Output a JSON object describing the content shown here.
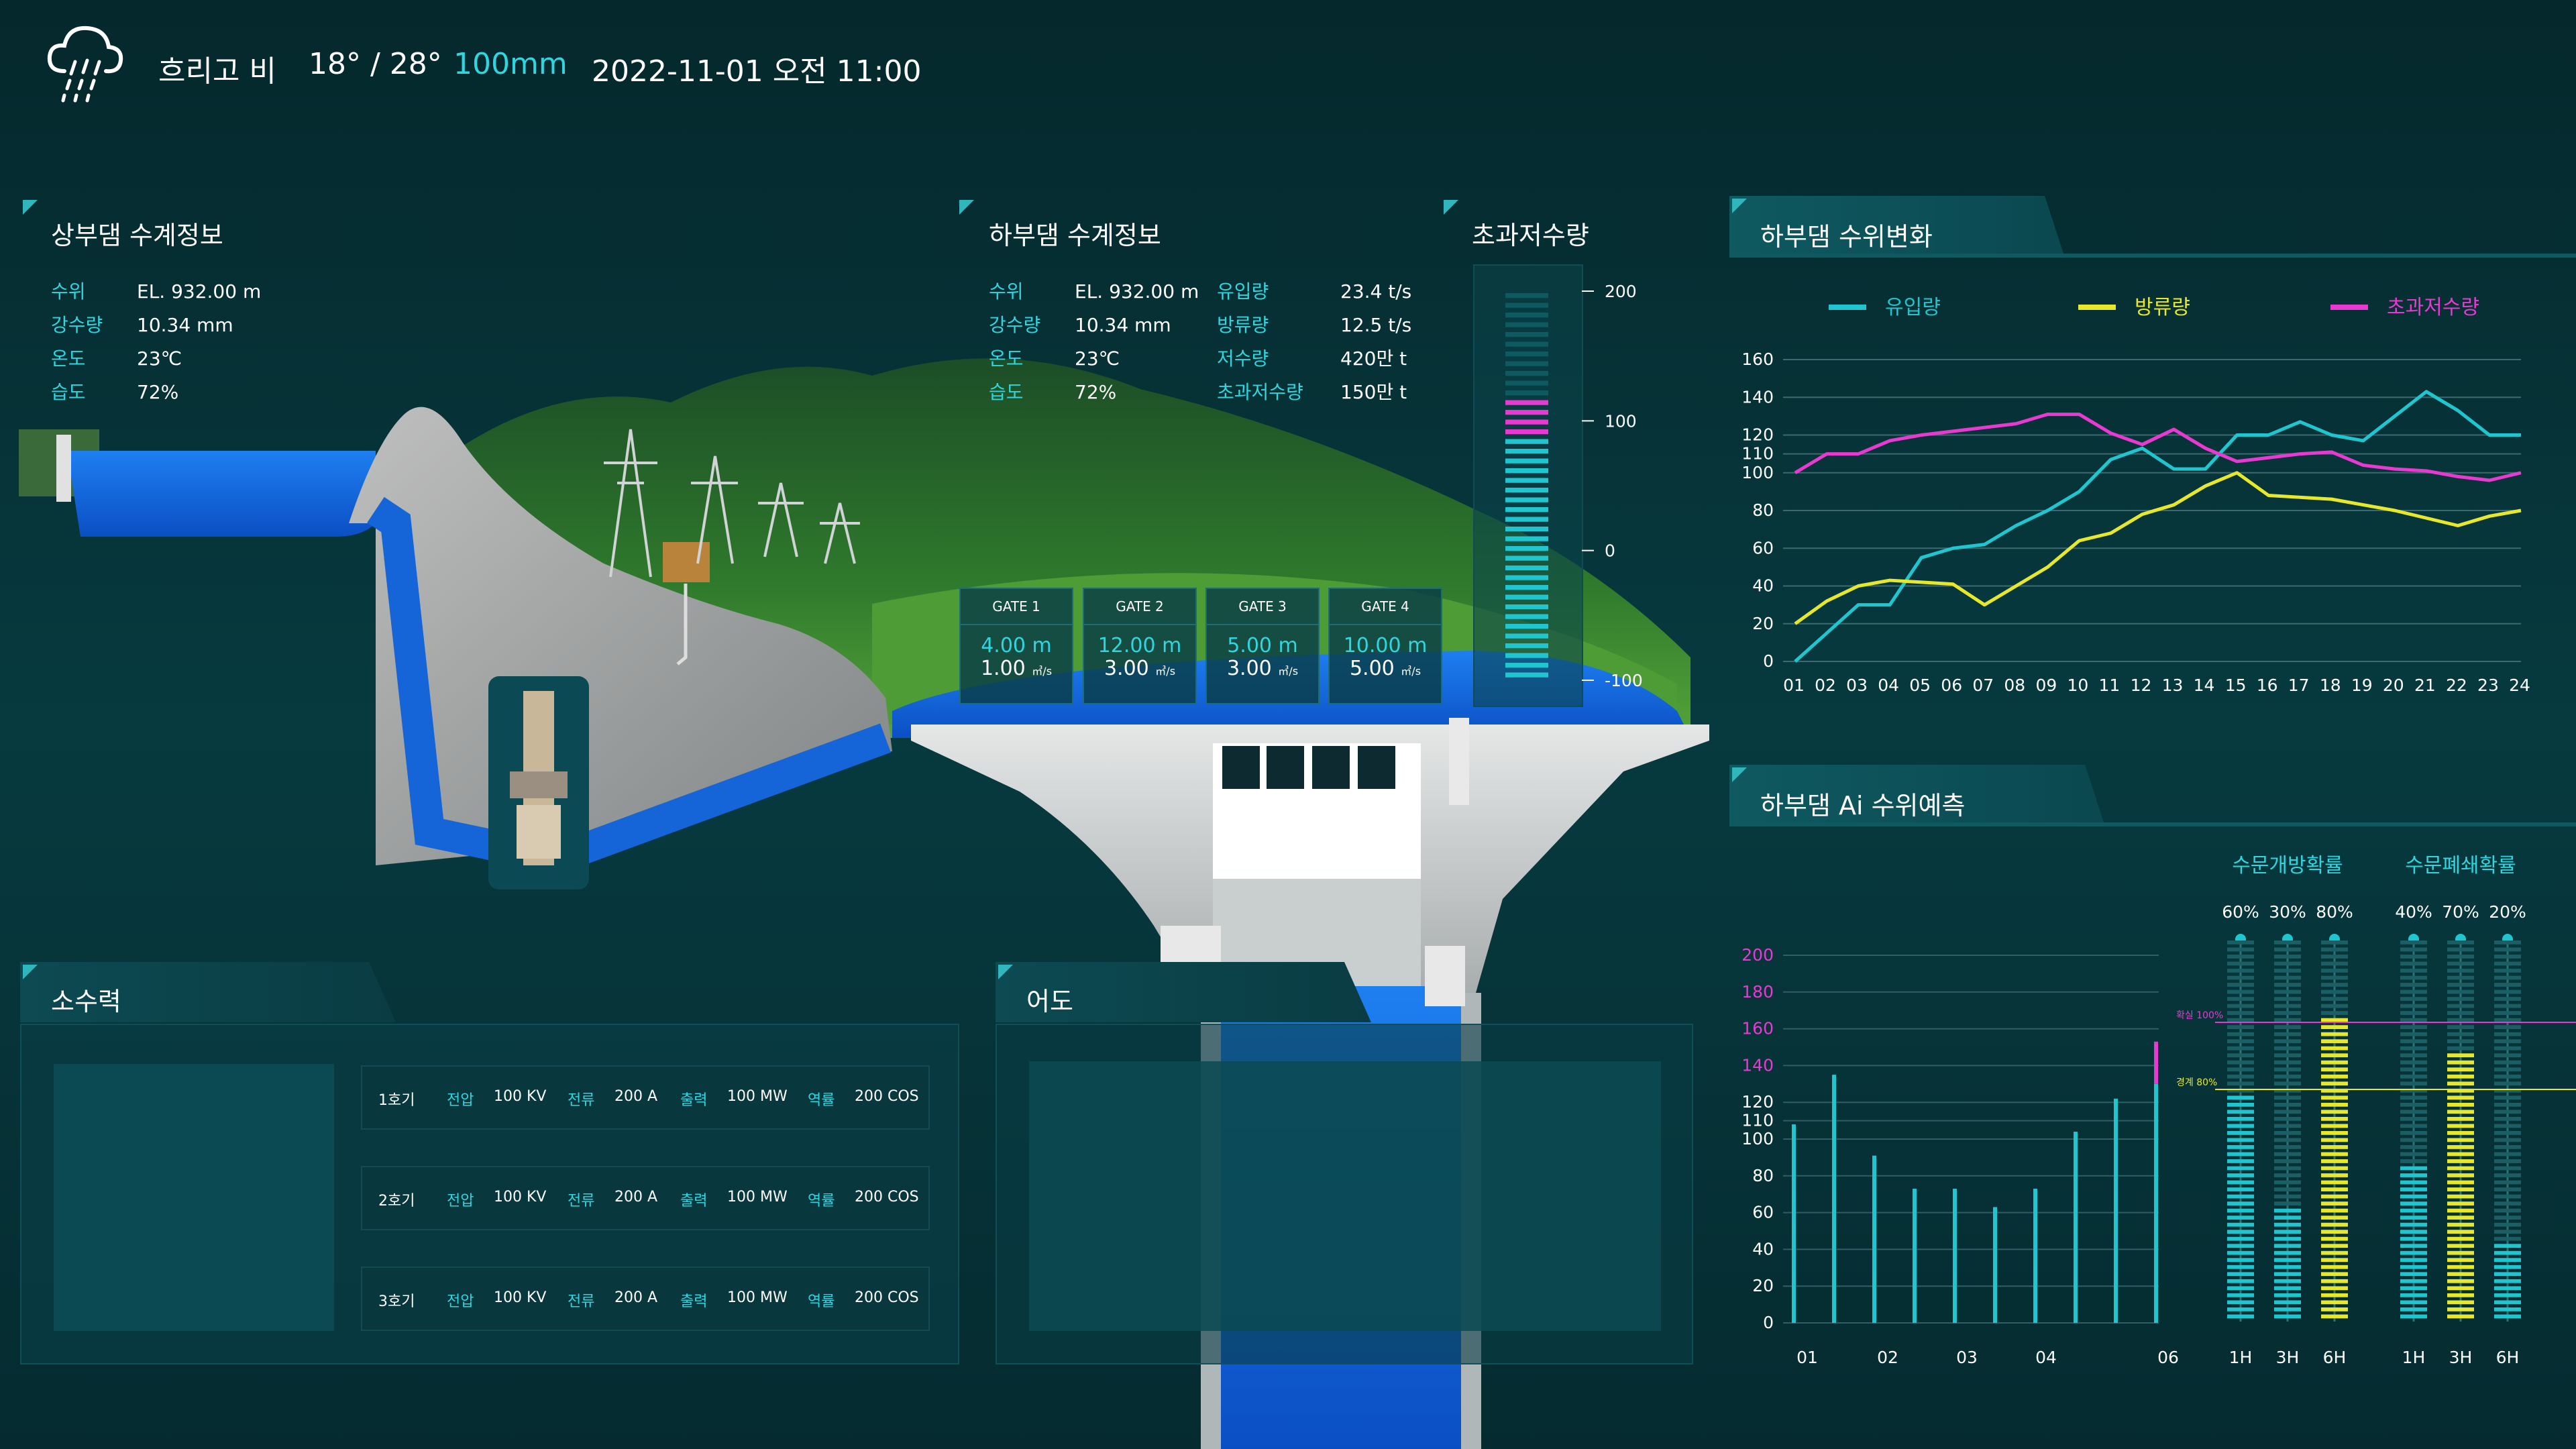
{
  "header": {
    "weather_icon": "cloud-rain-icon",
    "weather": "흐리고 비",
    "temperature": "18° / 28°",
    "rainfall": "100mm",
    "datetime": "2022-11-01 오전 11:00"
  },
  "upper_dam": {
    "title": "상부댐 수계정보",
    "rows": [
      {
        "label": "수위",
        "value": "EL. 932.00 m"
      },
      {
        "label": "강수량",
        "value": "10.34 mm"
      },
      {
        "label": "온도",
        "value": "23℃"
      },
      {
        "label": "습도",
        "value": "72%"
      }
    ]
  },
  "lower_dam": {
    "title": "하부댐 수계정보",
    "left_rows": [
      {
        "label": "수위",
        "value": "EL. 932.00 m"
      },
      {
        "label": "강수량",
        "value": "10.34 mm"
      },
      {
        "label": "온도",
        "value": "23℃"
      },
      {
        "label": "습도",
        "value": "72%"
      }
    ],
    "right_rows": [
      {
        "label": "유입량",
        "value": "23.4 t/s"
      },
      {
        "label": "방류량",
        "value": "12.5 t/s"
      },
      {
        "label": "저수량",
        "value": "420만 t"
      },
      {
        "label": "초과저수량",
        "value": "150만 t"
      }
    ]
  },
  "gates": [
    {
      "name": "GATE 1",
      "height": "4.00 m",
      "flow": "1.00",
      "unit": "㎥/s"
    },
    {
      "name": "GATE 2",
      "height": "12.00 m",
      "flow": "3.00",
      "unit": "㎥/s"
    },
    {
      "name": "GATE 3",
      "height": "5.00 m",
      "flow": "3.00",
      "unit": "㎥/s"
    },
    {
      "name": "GATE 4",
      "height": "10.00 m",
      "flow": "5.00",
      "unit": "㎥/s"
    }
  ],
  "excess_storage": {
    "title": "초과저수량",
    "ticks": [
      "200",
      "100",
      "0",
      "-100"
    ],
    "scale_min": -100,
    "scale_max": 200,
    "level_value": 115,
    "colors": {
      "empty": "#0e5a61",
      "alert": "#e83ad0",
      "fill": "#1fc6cf"
    }
  },
  "hydro": {
    "title": "소수력",
    "units": [
      {
        "name": "1호기",
        "v_label": "전압",
        "v": "100 KV",
        "c_label": "전류",
        "c": "200 A",
        "o_label": "출력",
        "o": "100 MW",
        "p_label": "역률",
        "p": "200 COS"
      },
      {
        "name": "2호기",
        "v_label": "전압",
        "v": "100 KV",
        "c_label": "전류",
        "c": "200 A",
        "o_label": "출력",
        "o": "100 MW",
        "p_label": "역률",
        "p": "200 COS"
      },
      {
        "name": "3호기",
        "v_label": "전압",
        "v": "100 KV",
        "c_label": "전류",
        "c": "200 A",
        "o_label": "출력",
        "o": "100 MW",
        "p_label": "역률",
        "p": "200 COS"
      }
    ]
  },
  "fishway": {
    "title": "어도"
  },
  "water_level_change": {
    "title": "하부댐 수위변화",
    "legend": [
      {
        "name": "유입량",
        "color": "#1fc6cf"
      },
      {
        "name": "방류량",
        "color": "#e8e82a"
      },
      {
        "name": "초과저수량",
        "color": "#e83ad0"
      }
    ]
  },
  "ai_forecast": {
    "title": "하부댐 Ai 수위예측",
    "open_prob": {
      "title": "수문개방확률",
      "values": [
        "60%",
        "30%",
        "80%"
      ],
      "horizons": [
        "1H",
        "3H",
        "6H"
      ]
    },
    "close_prob": {
      "title": "수문폐쇄확률",
      "values": [
        "40%",
        "70%",
        "20%"
      ],
      "horizons": [
        "1H",
        "3H",
        "6H"
      ]
    },
    "line_labels": {
      "confirm": "확실 100%",
      "warning": "경계 80%"
    }
  },
  "chart_data": [
    {
      "type": "line",
      "title": "하부댐 수위변화",
      "x": [
        "01",
        "02",
        "03",
        "04",
        "05",
        "06",
        "07",
        "08",
        "09",
        "10",
        "11",
        "12",
        "13",
        "14",
        "15",
        "16",
        "17",
        "18",
        "19",
        "20",
        "21",
        "22",
        "23",
        "24"
      ],
      "y_ticks": [
        "0",
        "20",
        "40",
        "60",
        "80",
        "100",
        "110",
        "120",
        "140",
        "160"
      ],
      "ylim": [
        0,
        160
      ],
      "grid": true,
      "legend": "top",
      "series": [
        {
          "name": "유입량",
          "color": "#1fc6cf",
          "values": [
            0,
            15,
            30,
            30,
            55,
            60,
            62,
            72,
            80,
            90,
            107,
            113,
            102,
            102,
            120,
            120,
            127,
            120,
            117,
            130,
            143,
            133,
            120,
            120
          ]
        },
        {
          "name": "방류량",
          "color": "#e8e82a",
          "values": [
            20,
            32,
            40,
            43,
            42,
            41,
            30,
            40,
            50,
            64,
            68,
            78,
            83,
            93,
            100,
            88,
            87,
            86,
            83,
            80,
            76,
            72,
            77,
            80
          ]
        },
        {
          "name": "초과저수량",
          "color": "#e83ad0",
          "values": [
            100,
            110,
            110,
            117,
            120,
            122,
            124,
            126,
            131,
            131,
            121,
            115,
            123,
            113,
            106,
            108,
            110,
            111,
            104,
            102,
            101,
            98,
            96,
            100
          ]
        }
      ]
    },
    {
      "type": "bar",
      "title": "하부댐 Ai 수위예측",
      "x_ticks": [
        "01",
        "02",
        "03",
        "04",
        "06"
      ],
      "y_ticks": [
        "0",
        "20",
        "40",
        "60",
        "80",
        "100",
        "110",
        "120",
        "140",
        "160",
        "180",
        "200"
      ],
      "ylim": [
        0,
        200
      ],
      "values": [
        108,
        135,
        91,
        73,
        73,
        63,
        73,
        104,
        122,
        130
      ],
      "forecast_extension": {
        "from": 130,
        "to": 153,
        "color": "#e83ad0"
      }
    },
    {
      "type": "bar",
      "title": "수문개방확률",
      "categories": [
        "1H",
        "3H",
        "6H"
      ],
      "values": [
        60,
        30,
        80
      ],
      "colors": [
        "#1fc6cf",
        "#1fc6cf",
        "#e8e82a"
      ]
    },
    {
      "type": "bar",
      "title": "수문폐쇄확률",
      "categories": [
        "1H",
        "3H",
        "6H"
      ],
      "values": [
        40,
        70,
        20
      ],
      "colors": [
        "#1fc6cf",
        "#e8e82a",
        "#1fc6cf"
      ]
    }
  ]
}
